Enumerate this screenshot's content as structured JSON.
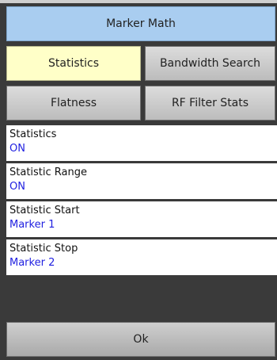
{
  "title": "Marker Math",
  "buttons": {
    "statistics": "Statistics",
    "bandwidth_search": "Bandwidth Search",
    "flatness": "Flatness",
    "rf_filter_stats": "RF Filter Stats"
  },
  "properties": [
    {
      "label": "Statistics",
      "value": "ON"
    },
    {
      "label": "Statistic Range",
      "value": "ON"
    },
    {
      "label": "Statistic Start",
      "value": "Marker 1"
    },
    {
      "label": "Statistic Stop",
      "value": "Marker 2"
    }
  ],
  "ok_label": "Ok",
  "colors": {
    "title_bg": "#a9cdf0",
    "active_button_bg": "#ffffc8",
    "value_text": "#1f1fe0",
    "panel_bg": "#3a3a3a"
  }
}
